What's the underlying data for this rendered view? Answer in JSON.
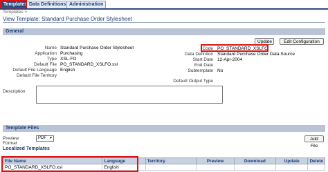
{
  "tabs": [
    {
      "label": "Templates"
    },
    {
      "label": "Data Definitions"
    },
    {
      "label": "Administration"
    }
  ],
  "breadcrumb": "Templates >",
  "page_title": "View Template: Standard Purchase Order Stylesheet",
  "general": {
    "header": "General",
    "update_label": "Update",
    "edit_config_label": "Edit Configuration",
    "left_fields": [
      {
        "label": "Name",
        "value": "Standard Purchase Order Stylesheet"
      },
      {
        "label": "Application",
        "value": "Purchasing"
      },
      {
        "label": "Type",
        "value": "XSL-FO"
      },
      {
        "label": "Default File",
        "value": "PO_STANDARD_XSLFO.xsl"
      },
      {
        "label": "Default File Language",
        "value": "English"
      },
      {
        "label": "Default File Territory",
        "value": ""
      }
    ],
    "right_fields": [
      {
        "label": "Code",
        "value": "PO_STANDARD_XSLFO"
      },
      {
        "label": "Data Definiton",
        "value": "Standard Purchase Order Data Source"
      },
      {
        "label": "Start Date",
        "value": "12-Apr-2004"
      },
      {
        "label": "End Date",
        "value": ""
      },
      {
        "label": "Subtemplate",
        "value": "No"
      },
      {
        "label": "Default Output Type",
        "value": ""
      }
    ],
    "description_label": "Description"
  },
  "template_files": {
    "header": "Template Files",
    "preview_format_label": "Preview Format",
    "preview_format_value": "PDF",
    "add_file_label": "Add File"
  },
  "localized": {
    "header": "Localized Templates",
    "columns": [
      "File Name",
      "Language",
      "Territory",
      "Preview",
      "Download",
      "Update",
      "Delete"
    ],
    "rows": [
      {
        "file_name": "PO_STANDARD_XSLFO.xsl",
        "language": "English",
        "territory": "",
        "preview": "",
        "download": "",
        "update": "",
        "delete": ""
      }
    ]
  }
}
